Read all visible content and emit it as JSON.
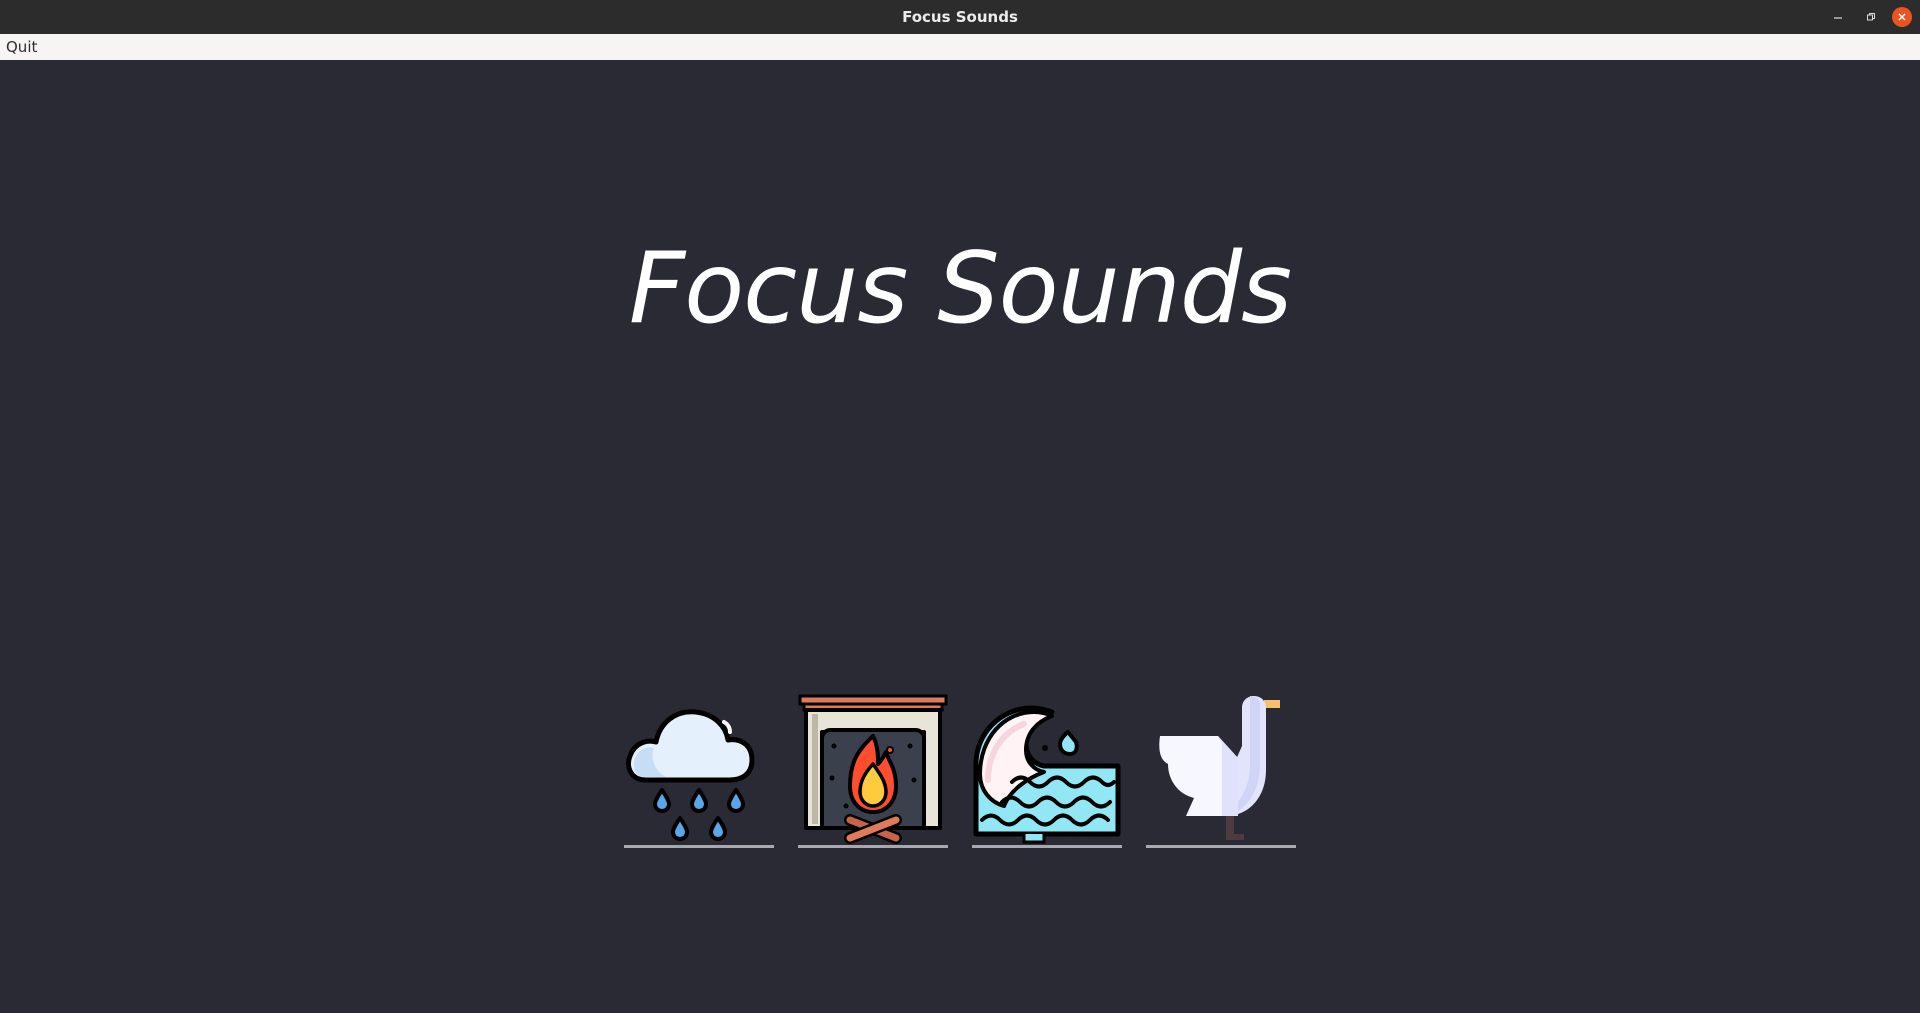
{
  "window": {
    "title": "Focus Sounds",
    "controls": {
      "minimize_icon": "minimize-icon",
      "restore_icon": "restore-icon",
      "close_icon": "close-icon"
    }
  },
  "menubar": {
    "items": [
      {
        "label": "Quit"
      }
    ]
  },
  "main": {
    "heading": "Focus Sounds",
    "sounds": [
      {
        "icon": "rain-cloud-icon"
      },
      {
        "icon": "fireplace-icon"
      },
      {
        "icon": "ocean-wave-icon"
      },
      {
        "icon": "seagull-icon"
      }
    ]
  },
  "colors": {
    "background": "#292a33",
    "titlebar": "#2c2c2c",
    "menubar": "#f6f5f4",
    "close_button": "#e95420",
    "heading_text": "#ffffff",
    "underline": "#a7a9ae"
  }
}
